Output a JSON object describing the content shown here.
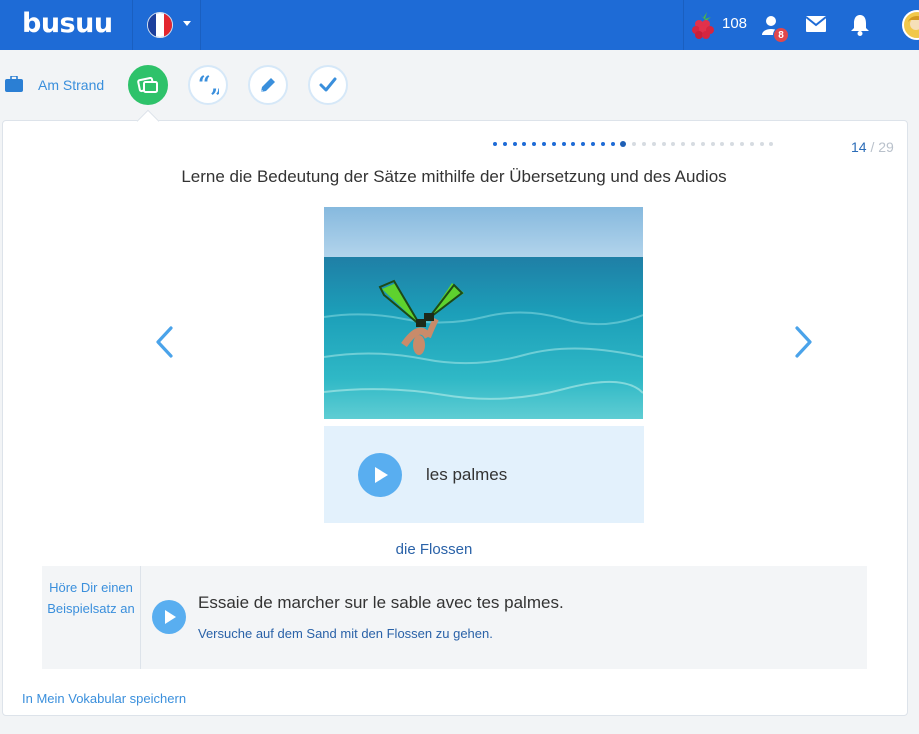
{
  "nav": {
    "logo": "busuu",
    "language": "French",
    "points": "108",
    "notifications_count": "8"
  },
  "lesson": {
    "name": "Am Strand",
    "steps": [
      "flashcard-icon",
      "quote-icon",
      "pencil-icon",
      "check-icon"
    ],
    "active_step": 0
  },
  "progress": {
    "current": "14",
    "total": "/ 29",
    "total_count": 29
  },
  "exercise": {
    "instruction": "Lerne die Bedeutung der Sätze mithilfe der Übersetzung und des Audios",
    "word": "les palmes",
    "translation": "die Flossen",
    "example_label": "Höre Dir einen Beispielsatz an",
    "example_sentence": "Essaie de marcher sur le sable avec tes palmes.",
    "example_translation": "Versuche auf dem Sand mit den Flossen zu gehen."
  },
  "footer": {
    "save_link": "In Mein Vokabular speichern"
  },
  "colors": {
    "brand_blue": "#1e6bd6",
    "accent_green": "#2ec26a",
    "link_blue": "#3a8fdc",
    "play_blue": "#59aef0"
  }
}
